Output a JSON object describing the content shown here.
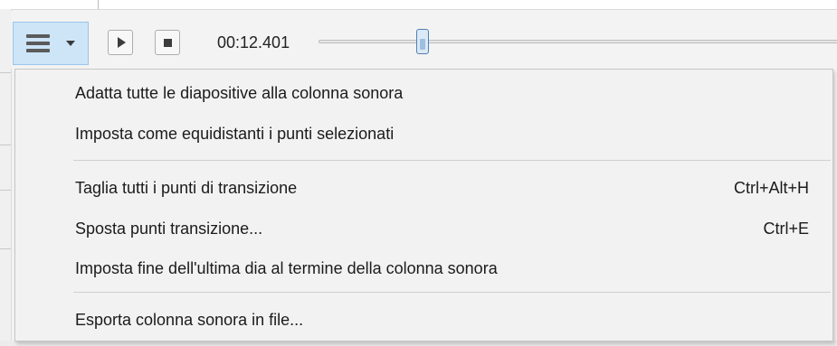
{
  "toolbar": {
    "menu_icon": "hamburger-menu-icon",
    "caret_icon": "chevron-down-icon",
    "play_icon": "play-icon",
    "stop_icon": "stop-icon",
    "time": "00:12.401",
    "playback_position_fraction": 0.2
  },
  "menu": {
    "groups": [
      [
        {
          "label": "Adatta tutte le diapositive alla colonna sonora",
          "shortcut": ""
        },
        {
          "label": "Imposta come equidistanti i punti selezionati",
          "shortcut": ""
        }
      ],
      [
        {
          "label": "Taglia tutti i punti  di transizione",
          "shortcut": "Ctrl+Alt+H"
        },
        {
          "label": "Sposta punti transizione...",
          "shortcut": "Ctrl+E"
        },
        {
          "label": "Imposta fine dell'ultima dia al termine della colonna sonora",
          "shortcut": ""
        }
      ],
      [
        {
          "label": "Esporta colonna sonora in file...",
          "shortcut": ""
        }
      ]
    ]
  },
  "colors": {
    "menu_button_bg": "#cde5f7",
    "menu_bg": "#f2f2f2",
    "slider_thumb_border": "#4f80b5"
  }
}
